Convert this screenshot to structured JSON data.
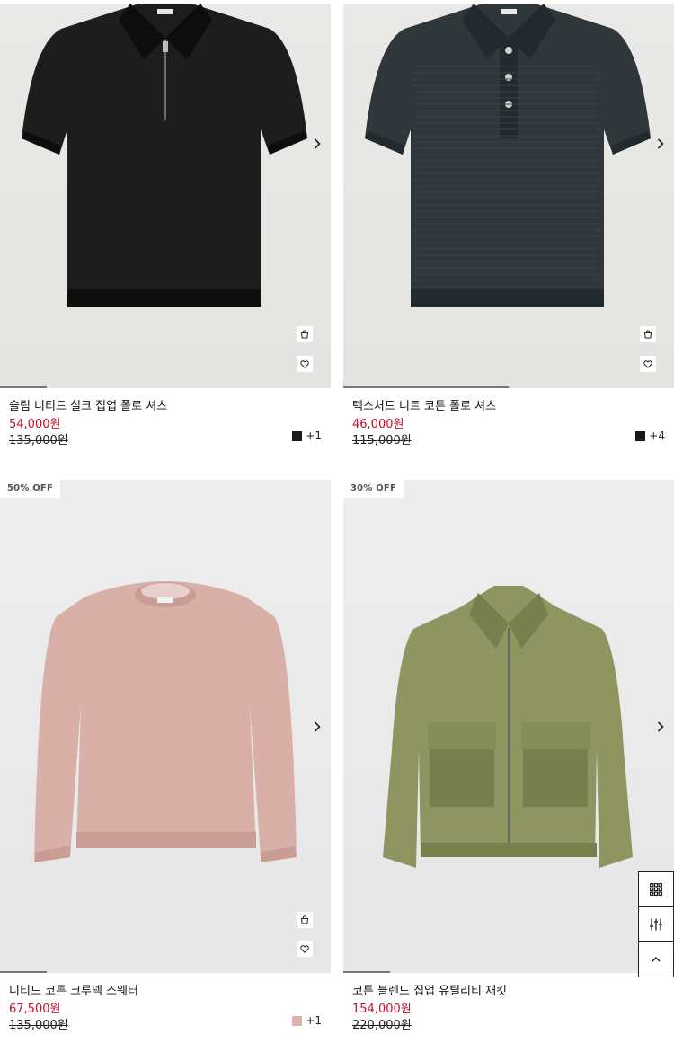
{
  "products": [
    {
      "name": "슬림 니티드 실크 집업 폴로 셔츠",
      "sale_price": "54,000원",
      "original_price": "135,000원",
      "badge": "",
      "swatch_color": "#1a1a1a",
      "more_colors": "+1",
      "garment": "zip-polo",
      "garment_color": "#1d1d1d",
      "image_progress": 0.14
    },
    {
      "name": "텍스처드 니트 코튼 폴로 셔츠",
      "sale_price": "46,000원",
      "original_price": "115,000원",
      "badge": "",
      "swatch_color": "#1a1a1a",
      "more_colors": "+4",
      "garment": "button-polo",
      "garment_color": "#2f373a",
      "image_progress": 0.5
    },
    {
      "name": "니티드 코튼 크루넥 스웨터",
      "sale_price": "67,500원",
      "original_price": "135,000원",
      "badge": "50% OFF",
      "swatch_color": "#dbb3ac",
      "more_colors": "+1",
      "garment": "sweater",
      "garment_color": "#d9b0a8",
      "image_progress": 0.14
    },
    {
      "name": "코튼 블렌드 집업 유틸리티 재킷",
      "sale_price": "154,000원",
      "original_price": "220,000원",
      "badge": "30% OFF",
      "swatch_color": "",
      "more_colors": "",
      "garment": "jacket",
      "garment_color": "#8e9561",
      "image_progress": 0.14
    }
  ],
  "icons": {
    "next": "chevron-right-icon",
    "cart": "shopping-bag-icon",
    "wishlist": "heart-icon"
  },
  "floating_tools": [
    {
      "name": "grid-view-icon"
    },
    {
      "name": "filter-sliders-icon"
    },
    {
      "name": "chevron-up-icon"
    }
  ]
}
